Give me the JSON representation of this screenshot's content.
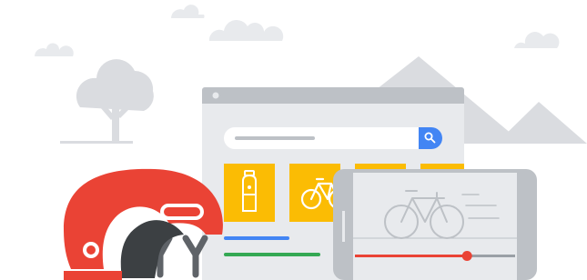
{
  "colors": {
    "background": "#ffffff",
    "cloud": "#e8eaed",
    "mountain": "#dadce0",
    "tree": "#dadce0",
    "browser_frame": "#bdc1c6",
    "browser_body": "#e8eaed",
    "search_box": "#ffffff",
    "search_line": "#bdc1c6",
    "search_button": "#4285f4",
    "tile_yellow": "#fbbc04",
    "tile_icon": "#ffffff",
    "line_blue": "#4285f4",
    "line_green": "#34a853",
    "phone_frame": "#bdc1c6",
    "phone_screen": "#e8eaed",
    "bike_outline": "#bdc1c6",
    "video_progress": "#ea4335",
    "video_track": "#9aa0a6",
    "helmet_red": "#ea4335",
    "helmet_dark": "#3c4043",
    "helmet_strap": "#5f6368"
  },
  "icons": {
    "search_button": "search-icon",
    "tile_1": "water-bottle-icon",
    "tile_2": "bicycle-icon",
    "video": "bicycle-icon"
  },
  "video": {
    "progress": 0.7
  }
}
